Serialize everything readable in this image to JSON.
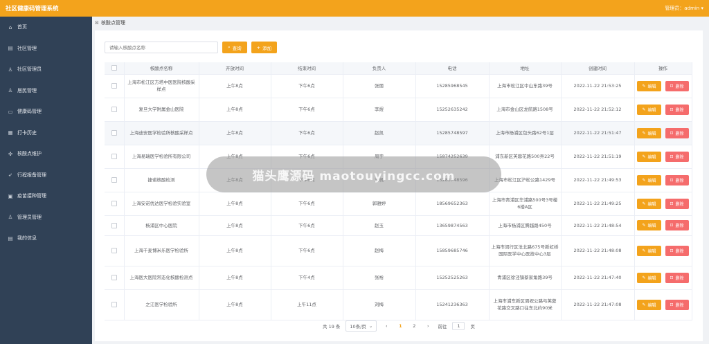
{
  "header": {
    "app_title": "社区健康码管理系统",
    "user_label": "管理员：admin",
    "user_caret": "▾"
  },
  "sidebar": {
    "items": [
      {
        "icon": "⌂",
        "label": "首页"
      },
      {
        "icon": "▤",
        "label": "社区管理"
      },
      {
        "icon": "♙",
        "label": "社区管理员"
      },
      {
        "icon": "♙",
        "label": "居民管理"
      },
      {
        "icon": "▭",
        "label": "健康码管理"
      },
      {
        "icon": "▦",
        "label": "打卡历史"
      },
      {
        "icon": "✜",
        "label": "核酸点维护"
      },
      {
        "icon": "➶",
        "label": "行程报备管理"
      },
      {
        "icon": "▣",
        "label": "疫苗接种管理"
      },
      {
        "icon": "♙",
        "label": "管理员管理"
      },
      {
        "icon": "▤",
        "label": "我的信息"
      }
    ]
  },
  "breadcrumb": {
    "icon": "⊠",
    "text": "核酸点管理"
  },
  "toolbar": {
    "search_placeholder": "请输入核酸点名称",
    "search_icon": "⌕",
    "search_label": "查询",
    "add_icon": "+",
    "add_label": "添加"
  },
  "table": {
    "headers": [
      "",
      "核酸点名称",
      "开放时间",
      "结束时间",
      "负责人",
      "电话",
      "地址",
      "创建时间",
      "操作"
    ],
    "edit_icon": "✎",
    "edit_label": "编辑",
    "delete_icon": "⊡",
    "delete_label": "删除",
    "rows": [
      {
        "name": "上海市松江区方塔中医医院核酸采样点",
        "open": "上午8点",
        "close": "下午6点",
        "person": "张丽",
        "phone": "15285968545",
        "address": "上海市松江区中山东路39号",
        "created": "2022-11-22 21:53:25"
      },
      {
        "name": "复旦大学附属金山医院",
        "open": "上午8点",
        "close": "下午6点",
        "person": "李煜",
        "phone": "15252635242",
        "address": "上海市金山区龙航路1508号",
        "created": "2022-11-22 21:52:12"
      },
      {
        "name": "上海迪安医学检验所核酸采样点",
        "open": "上午8点",
        "close": "下午6点",
        "person": "赵凯",
        "phone": "15285748597",
        "address": "上海市杨浦区包头路62号1层",
        "created": "2022-11-22 21:51:47"
      },
      {
        "name": "上海易瑞医学检验所有限公司",
        "open": "上午8点",
        "close": "下午6点",
        "person": "周宇",
        "phone": "15874252639",
        "address": "浦东新区芙蓉花路500弄22号",
        "created": "2022-11-22 21:51:19"
      },
      {
        "name": "捷诺核酸检测",
        "open": "上午8点",
        "close": "下午6点",
        "person": "王帆",
        "phone": "15285748596",
        "address": "上海市松江区沪松公路1429号",
        "created": "2022-11-22 21:49:53"
      },
      {
        "name": "上海安诺优达医学检验实验室",
        "open": "上午8点",
        "close": "下午6点",
        "person": "郭雅婷",
        "phone": "18569652363",
        "address": "上海市青浦区华浦路500号3号楼6楼A区",
        "created": "2022-11-22 21:49:25"
      },
      {
        "name": "杨浦区中心医院",
        "open": "上午8点",
        "close": "下午6点",
        "person": "赵玉",
        "phone": "13659874563",
        "address": "上海市杨浦区腾越路450号",
        "created": "2022-11-22 21:48:54"
      },
      {
        "name": "上海千麦博米乐医学检验所",
        "open": "上午8点",
        "close": "下午6点",
        "person": "赵梅",
        "phone": "15859685746",
        "address": "上海市闵行区沧北路675号新虹桥国际医学中心医技中心3层",
        "created": "2022-11-22 21:48:08"
      },
      {
        "name": "上海医大医院常态化核酸检测点",
        "open": "上午8点",
        "close": "下午4点",
        "person": "张裕",
        "phone": "15252525263",
        "address": "青浦区徐泾镇蔡家角路39号",
        "created": "2022-11-22 21:47:40"
      },
      {
        "name": "之江医学检验所",
        "open": "上午8点",
        "close": "上午11点",
        "person": "刘梅",
        "phone": "15241236363",
        "address": "上海市浦东新区周祝公路与芙蓉花路交叉路口往东北约90米",
        "created": "2022-11-22 21:47:08"
      }
    ]
  },
  "pagination": {
    "total_text": "共 19 条",
    "page_size": "10条/页",
    "prev": "‹",
    "pages": [
      "1",
      "2"
    ],
    "next": "›",
    "goto_label": "前往",
    "goto_value": "1",
    "goto_suffix": "页"
  },
  "watermark": {
    "text": "猫头鹰源码 maotouyingcc.com"
  }
}
